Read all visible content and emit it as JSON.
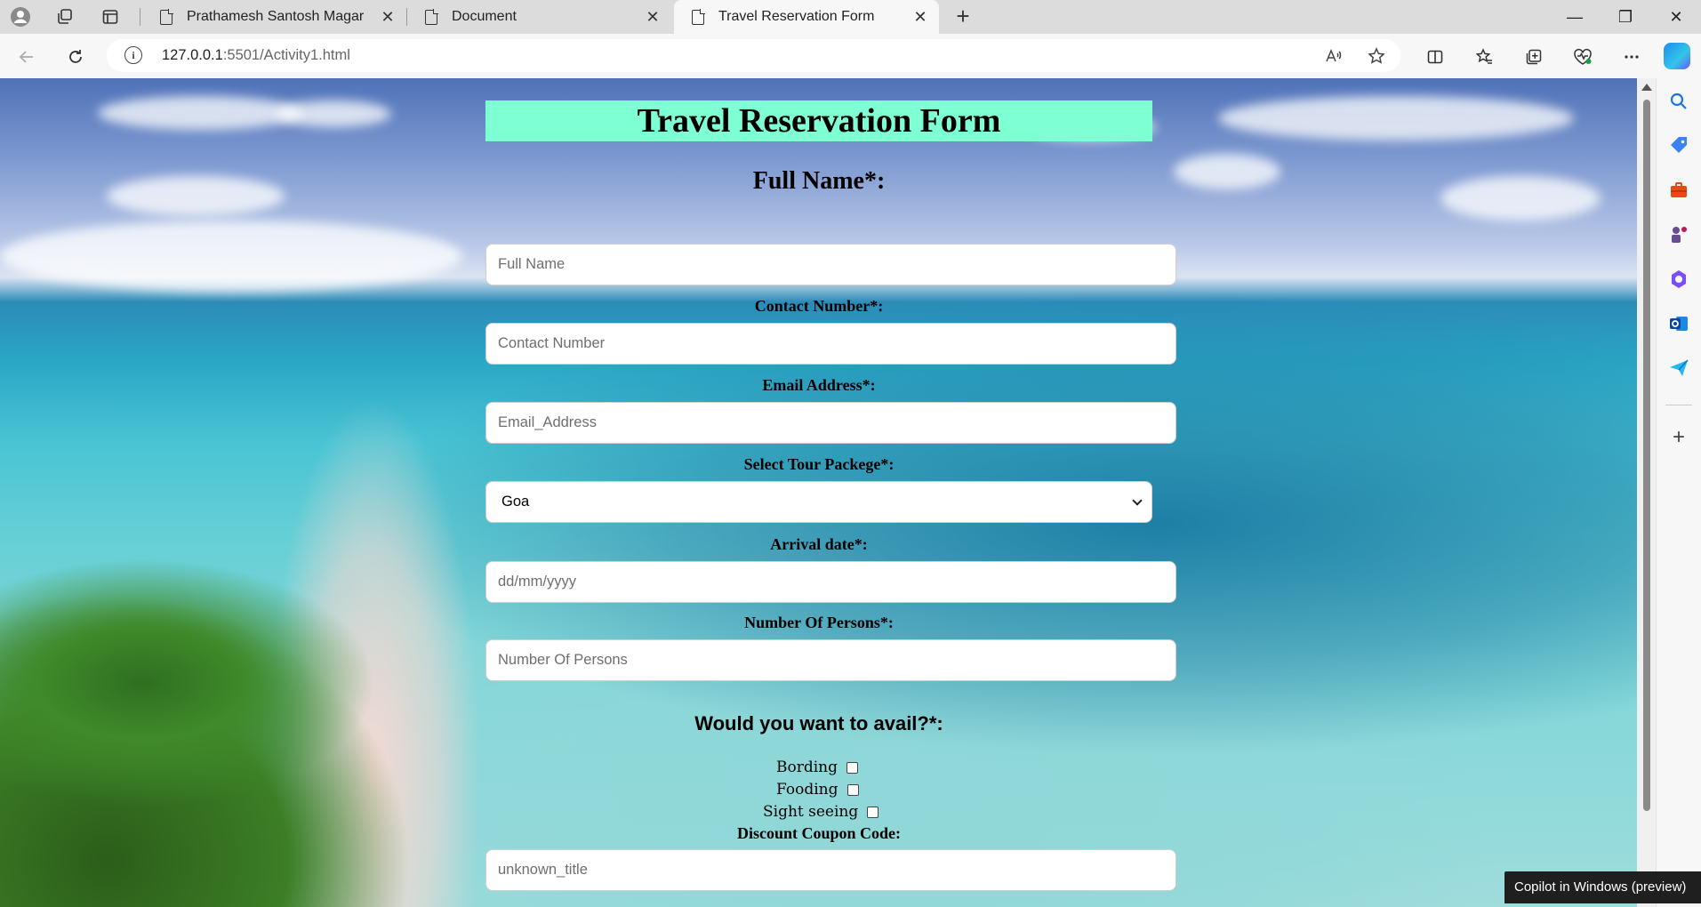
{
  "browser": {
    "tabs": [
      {
        "title": "Prathamesh Santosh Magar",
        "active": false
      },
      {
        "title": "Document",
        "active": false
      },
      {
        "title": "Travel Reservation Form",
        "active": true
      }
    ],
    "address": {
      "host": "127.0.0.1",
      "path": ":5501/Activity1.html"
    },
    "tab_close_glyph": "✕",
    "new_tab_glyph": "+",
    "window_controls": {
      "minimize": "—",
      "maximize": "❐",
      "close": "✕"
    }
  },
  "form": {
    "title": "Travel Reservation Form",
    "full_name": {
      "label": "Full Name*:",
      "placeholder": "Full Name"
    },
    "contact": {
      "label": "Contact Number*:",
      "placeholder": "Contact Number"
    },
    "email": {
      "label": "Email Address*:",
      "placeholder": "Email_Address"
    },
    "package": {
      "label": "Select Tour Packege*:",
      "selected": "Goa"
    },
    "arrival": {
      "label": "Arrival date*:",
      "placeholder": "dd/mm/yyyy"
    },
    "persons": {
      "label": "Number Of Persons*:",
      "placeholder": "Number Of Persons"
    },
    "avail": {
      "heading": "Would you want to avail?*:",
      "options": [
        "Bording",
        "Fooding",
        "Sight seeing"
      ]
    },
    "coupon": {
      "label": "Discount Coupon Code:",
      "placeholder": "unknown_title"
    }
  },
  "toast": "Copilot in Windows (preview)",
  "colors": {
    "title_bg": "#7fffd4",
    "tabbar_bg": "#dcdcdc",
    "toolbar_bg": "#f7f7f7",
    "toast_bg": "#1f1f1f"
  }
}
